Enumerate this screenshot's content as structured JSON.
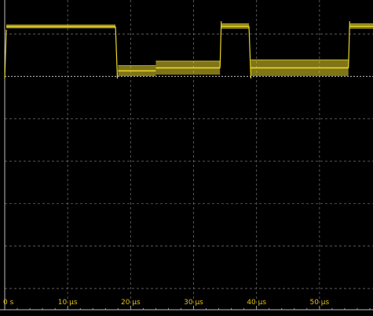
{
  "chart_data": {
    "type": "line",
    "x_unit": "µs",
    "xlim": [
      0,
      58.5
    ],
    "ylim": [
      -5.5,
      1.8
    ],
    "xticks": [
      0,
      10,
      20,
      30,
      40,
      50
    ],
    "xtick_labels": [
      "0 s",
      "10 µs",
      "20 µs",
      "30 µs",
      "40 µs",
      "50 µs"
    ],
    "yticks": [
      -5,
      -4,
      -3,
      -2,
      -1,
      0,
      1
    ],
    "grid": true,
    "series": [
      {
        "color": "#e8d62a",
        "segments": [
          {
            "x": [
              0,
              0.25
            ],
            "y": [
              -0.05,
              1.1
            ]
          },
          {
            "x": [
              0.25,
              17.6
            ],
            "y": [
              1.17,
              1.17
            ],
            "band": 0.08
          },
          {
            "x": [
              17.6,
              17.9
            ],
            "y": [
              1.17,
              -0.05
            ]
          },
          {
            "x": [
              18.0,
              24.0
            ],
            "y": [
              0.13,
              0.13
            ],
            "band": 0.25
          },
          {
            "x": [
              24.0,
              34.2
            ],
            "y": [
              0.2,
              0.2
            ],
            "band": 0.32
          },
          {
            "x": [
              34.2,
              34.4
            ],
            "y": [
              0.2,
              1.3
            ]
          },
          {
            "x": [
              34.4,
              38.8
            ],
            "y": [
              1.18,
              1.18
            ],
            "band": 0.12
          },
          {
            "x": [
              38.8,
              39.1
            ],
            "y": [
              1.18,
              -0.05
            ]
          },
          {
            "x": [
              39.1,
              54.6
            ],
            "y": [
              0.2,
              0.2
            ],
            "band": 0.38
          },
          {
            "x": [
              54.6,
              54.8
            ],
            "y": [
              0.2,
              1.3
            ]
          },
          {
            "x": [
              54.8,
              58.5
            ],
            "y": [
              1.18,
              1.18
            ],
            "band": 0.12
          }
        ]
      }
    ]
  },
  "colors": {
    "background": "#000000",
    "grid": "#6a6a6a",
    "axis": "#bdbdbd",
    "trace": "#e8d62a",
    "labels": "#e0c010"
  }
}
